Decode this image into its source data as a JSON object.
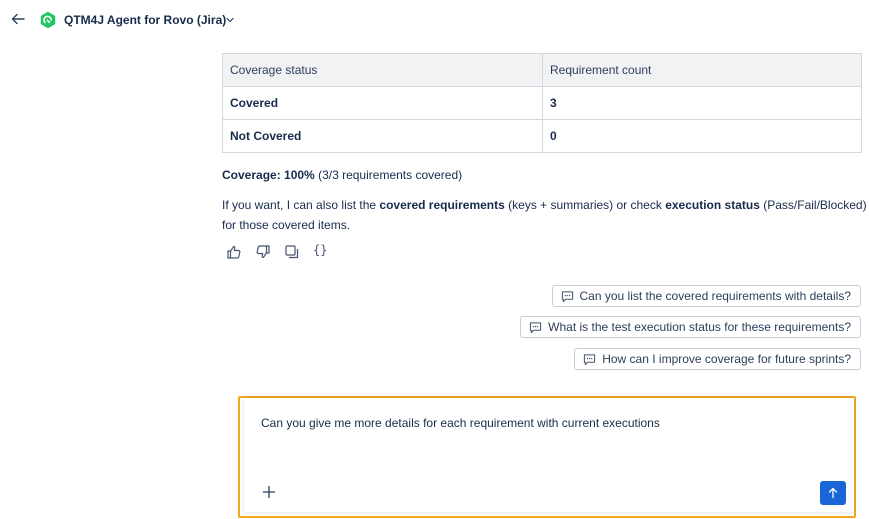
{
  "header": {
    "title": "QTM4J Agent for Rovo (Jira)",
    "logo_color": "#22c55e"
  },
  "table": {
    "headers": [
      "Coverage status",
      "Requirement count"
    ],
    "rows": [
      [
        "Covered",
        "3"
      ],
      [
        "Not Covered",
        "0"
      ]
    ]
  },
  "summary": {
    "coverage_label": "Coverage:",
    "coverage_value": "100%",
    "coverage_detail": "(3/3 requirements covered)"
  },
  "info": {
    "t1": "If you want, I can also list the ",
    "b1": "covered requirements",
    "t2": " (keys + summaries) or check ",
    "b2": "execution status",
    "t3": " (Pass/Fail/Blocked) for those covered items."
  },
  "feedback": {
    "icons": [
      "thumbs-up-icon",
      "thumbs-down-icon",
      "copy-icon",
      "code-braces-icon"
    ],
    "braces_label": "{}"
  },
  "suggestions": [
    "Can you list the covered requirements with details?",
    "What is the test execution status for these requirements?",
    "How can I improve coverage for future sprints?"
  ],
  "composer": {
    "value": "Can you give me more details for each requirement with current executions",
    "highlight_color": "#f2a81d",
    "send_color": "#1a65d8"
  }
}
